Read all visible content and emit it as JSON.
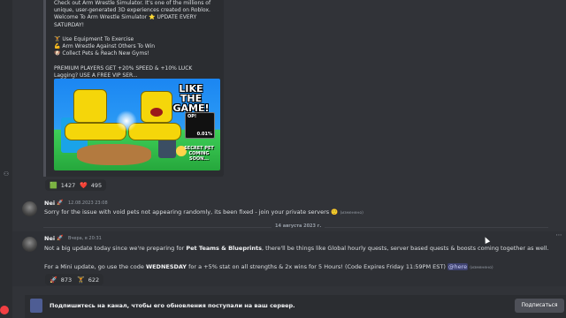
{
  "embed": {
    "description": "Check out Arm Wrestle Simulator. It's one of the millions of unique, user-generated 3D experiences created on Roblox. Welcome To Arm Wrestle Simulator ⭐ UPDATE EVERY SATURDAY!\n\n🏋 Use Equipment To Exercise\n💪 Arm Wrestle Against Others To Win\n🐶 Collect Pets & Reach New Gyms!\n\nPREMIUM PLAYERS GET +20% SPEED & +10% LUCK\nLagging? USE A FREE VIP SER...",
    "thumbnail": {
      "title": "LIKE THE GAME!",
      "op_label": "OP!",
      "op_percent": "0.01%",
      "secret_caption": "SECRET PET COMING SOON..."
    }
  },
  "embed_reactions": [
    {
      "emoji": "🟩",
      "count": "1427"
    },
    {
      "emoji": "❤️",
      "count": "495"
    }
  ],
  "messages": [
    {
      "author": "Nei",
      "role_icon": "rocket-icon",
      "timestamp": "12.08.2023 23:08",
      "text": "Sorry for the issue with void pets not appearing randomly, its been fixed - join your private servers",
      "emoji": "🙂",
      "edited": "(изменено)"
    },
    {
      "author": "Nei",
      "role_icon": "rocket-icon",
      "timestamp": "Вчера, в 20:31",
      "line1_pre": "Not a big update today since we're preparing for ",
      "line1_bold": "Pet Teams & Blueprints",
      "line1_post": ", there'll be things like Global hourly quests, server based quests & boosts coming together as well.",
      "line2_pre": "For a Mini update, go use the code ",
      "line2_code": "WEDNESDAY",
      "line2_post": " for a +5% stat on all strengths & 2x wins for 5 Hours! (Code Expires Friday 11:59PM EST) ",
      "mention": "@here",
      "edited": "(изменено)",
      "reactions": [
        {
          "emoji": "🚀",
          "count": "873"
        },
        {
          "emoji": "🏋",
          "count": "622"
        }
      ]
    }
  ],
  "date_divider": "14 августа 2023 г.",
  "follow_bar": {
    "text": "Подпишитесь на канал, чтобы его обновления поступали на ваш сервер.",
    "button": "Подписаться"
  },
  "colors": {
    "background": "#313338",
    "sidebar": "#2b2d31",
    "mention_bg": "#3e4270",
    "badge_red": "#f23f43"
  }
}
